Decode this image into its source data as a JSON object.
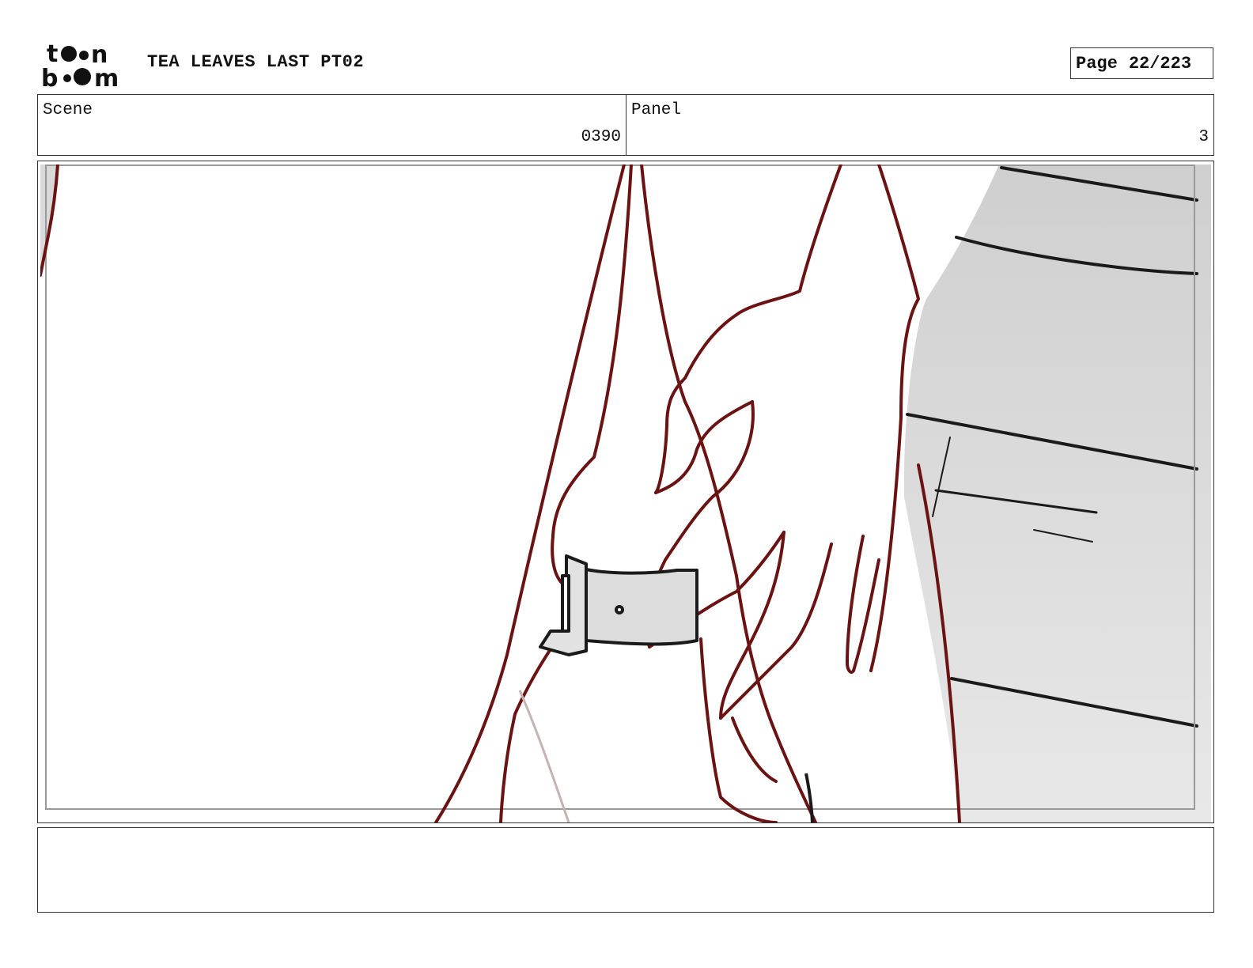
{
  "header": {
    "logo_icon": "toonboom-logo",
    "logo_text": "toonboom",
    "project_title": "TEA LEAVES LAST PT02",
    "page_label": "Page",
    "page_value": "22/223"
  },
  "scene": {
    "label": "Scene",
    "value": "0390"
  },
  "panel": {
    "label": "Panel",
    "value": "3"
  },
  "drawing": {
    "line_color": "#6b1212",
    "shade_color": "#d9d9d9"
  },
  "notes": {
    "text": ""
  }
}
